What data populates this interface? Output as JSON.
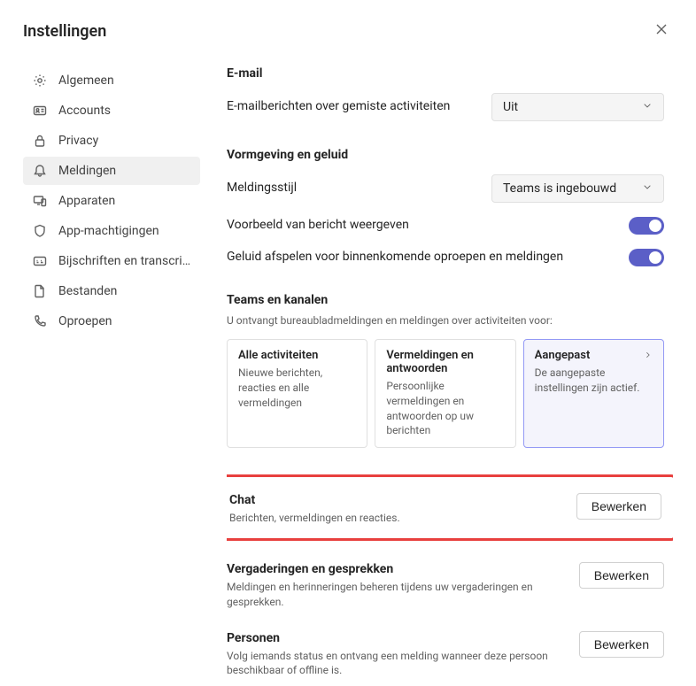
{
  "header": {
    "title": "Instellingen"
  },
  "sidebar": {
    "items": [
      {
        "label": "Algemeen"
      },
      {
        "label": "Accounts"
      },
      {
        "label": "Privacy"
      },
      {
        "label": "Meldingen"
      },
      {
        "label": "Apparaten"
      },
      {
        "label": "App-machtigingen"
      },
      {
        "label": "Bijschriften en transcript..."
      },
      {
        "label": "Bestanden"
      },
      {
        "label": "Oproepen"
      }
    ]
  },
  "email": {
    "title": "E-mail",
    "missed_label": "E-mailberichten over gemiste activiteiten",
    "missed_value": "Uit"
  },
  "appearance": {
    "title": "Vormgeving en geluid",
    "style_label": "Meldingsstijl",
    "style_value": "Teams is ingebouwd",
    "preview_label": "Voorbeeld van bericht weergeven",
    "sound_label": "Geluid afspelen voor binnenkomende oproepen en meldingen"
  },
  "teams_channels": {
    "title": "Teams en kanalen",
    "desc": "U ontvangt bureaubladmeldingen en meldingen over activiteiten voor:",
    "cards": [
      {
        "title": "Alle activiteiten",
        "desc": "Nieuwe berichten, reacties en alle vermeldingen"
      },
      {
        "title": "Vermeldingen en antwoorden",
        "desc": "Persoonlijke vermeldingen en antwoorden op uw berichten"
      },
      {
        "title": "Aangepast",
        "desc": "De aangepaste instellingen zijn actief."
      }
    ]
  },
  "chat": {
    "title": "Chat",
    "desc": "Berichten, vermeldingen en reacties.",
    "edit": "Bewerken"
  },
  "meetings": {
    "title": "Vergaderingen en gesprekken",
    "desc": "Meldingen en herinneringen beheren tijdens uw vergaderingen en gesprekken.",
    "edit": "Bewerken"
  },
  "people": {
    "title": "Personen",
    "desc": "Volg iemands status en ontvang een melding wanneer deze persoon beschikbaar of offline is.",
    "edit": "Bewerken"
  }
}
